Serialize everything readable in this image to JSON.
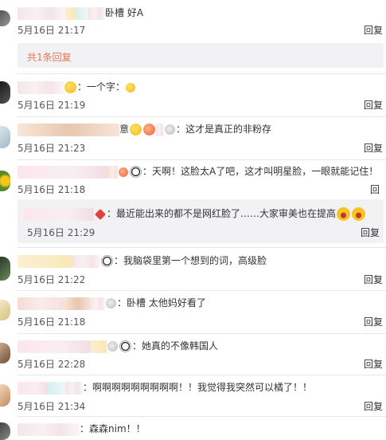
{
  "comments": [
    {
      "text": "卧槽 好A",
      "time": "5月16日 21:17",
      "reply": "回复"
    },
    {
      "text": "：一个字：",
      "time": "5月16日 21:19",
      "reply": "回复"
    },
    {
      "name_fragment": "意",
      "text": "：这才是真正的非粉存",
      "time": "5月16日 21:23",
      "reply": "回复"
    },
    {
      "text": "：天啊！这脸太A了吧，这才叫明星脸，一眼就能记住！",
      "time": "5月16日 21:18",
      "reply": "回"
    },
    {
      "text": "：我脑袋里第一个想到的词，高级脸",
      "time": "5月16日 21:22",
      "reply": "回复"
    },
    {
      "text": "：卧槽 太他妈好看了",
      "time": "5月16日 21:18",
      "reply": "回复"
    },
    {
      "text": "：她真的不像韩国人",
      "time": "5月16日 22:28",
      "reply": "回复"
    },
    {
      "text": "：啊啊啊啊啊啊啊啊啊！！我觉得我突然可以橘了！！",
      "time": "5月16日 21:34",
      "reply": "回复"
    },
    {
      "text": "：森森nim！！"
    }
  ],
  "thread1": {
    "count_text": "共1条回复"
  },
  "subreply": {
    "text": "：最近能出来的都不是网红脸了……大家审美也在提高",
    "time": "5月16日 21:29",
    "reply": "回复"
  },
  "colors": {
    "link": "#eb7350",
    "panel": "#f2f2f5",
    "divider": "#e6e6e6"
  },
  "icons": [
    "crown-badge-icon",
    "smile-emoji-icon",
    "medal-icon",
    "panda-emoji-icon",
    "heart-emoji-icon",
    "laugh-emoji-icon",
    "red-badge-icon"
  ]
}
